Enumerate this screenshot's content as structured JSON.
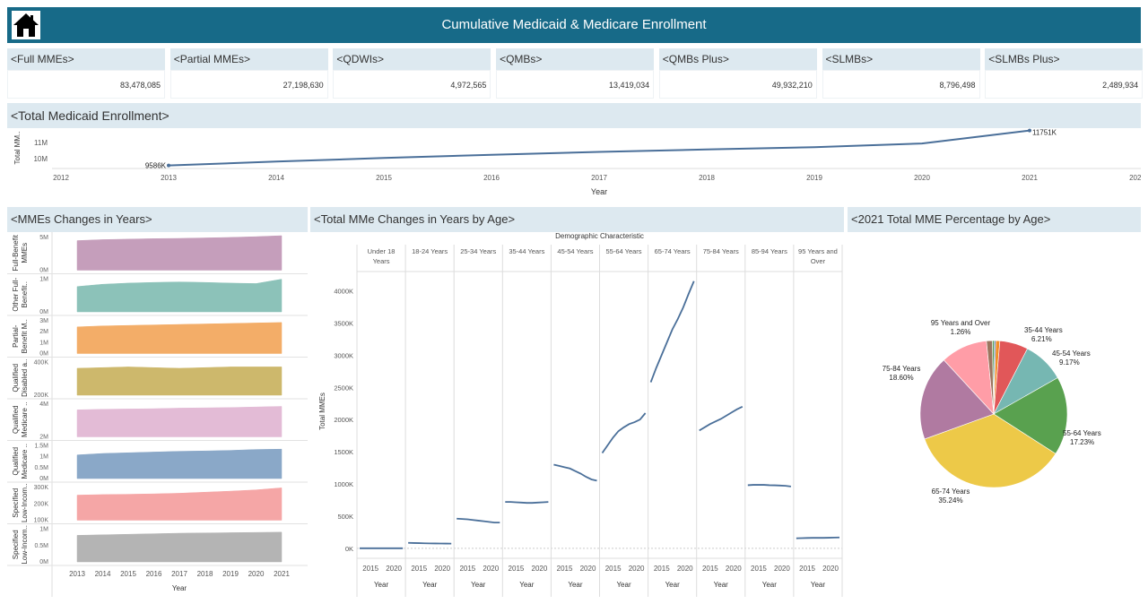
{
  "header": {
    "title": "Cumulative Medicaid & Medicare Enrollment",
    "home_icon": "home-icon"
  },
  "kpis": [
    {
      "label": "<Full MMEs>",
      "value": "83,478,085"
    },
    {
      "label": "<Partial MMEs>",
      "value": "27,198,630"
    },
    {
      "label": "<QDWIs>",
      "value": "4,972,565"
    },
    {
      "label": "<QMBs>",
      "value": "13,419,034"
    },
    {
      "label": "<QMBs Plus>",
      "value": "49,932,210"
    },
    {
      "label": "<SLMBs>",
      "value": "8,796,498"
    },
    {
      "label": "<SLMBs Plus>",
      "value": "2,489,934"
    }
  ],
  "medicaid": {
    "title": "<Total Medicaid Enrollment>",
    "ylabel": "Total MM..",
    "xlabel": "Year",
    "yticks": [
      "11M",
      "10M"
    ],
    "xticks": [
      "2012",
      "2013",
      "2014",
      "2015",
      "2016",
      "2017",
      "2018",
      "2019",
      "2020",
      "2021",
      "2022"
    ],
    "start_label": "9586K",
    "end_label": "11751K"
  },
  "mme_years": {
    "title": "<MMEs Changes in Years>",
    "xlabel": "Year",
    "xticks": [
      "2013",
      "2014",
      "2015",
      "2016",
      "2017",
      "2018",
      "2019",
      "2020",
      "2021"
    ],
    "rows": [
      {
        "label1": "Full-Benefit",
        "label2": "MMEs",
        "ticks": [
          "5M",
          "0M"
        ]
      },
      {
        "label1": "Other Full-",
        "label2": "Benefit..",
        "ticks": [
          "1M",
          "0M"
        ]
      },
      {
        "label1": "Partial-",
        "label2": "Benefit M..",
        "ticks": [
          "3M",
          "2M",
          "1M",
          "0M"
        ]
      },
      {
        "label1": "Qualified",
        "label2": "Disabled a..",
        "ticks": [
          "400K",
          "200K"
        ]
      },
      {
        "label1": "Qualified",
        "label2": "Medicare ..",
        "ticks": [
          "4M",
          "2M"
        ]
      },
      {
        "label1": "Qualified",
        "label2": "Medicare ..",
        "ticks": [
          "1.5M",
          "1M",
          "0.5M",
          "0M"
        ]
      },
      {
        "label1": "Specified",
        "label2": "Low-Incom..",
        "ticks": [
          "300K",
          "200K",
          "100K"
        ]
      },
      {
        "label1": "Specified",
        "label2": "Low-Incom..",
        "ticks": [
          "1M",
          "0.5M",
          "0M"
        ]
      }
    ]
  },
  "age_changes": {
    "title": "<Total MMe Changes in Years by Age>",
    "group_header": "Demographic Characteristic",
    "ylabel": "Total MMEs",
    "xlabel": "Year",
    "xticks": [
      "2015",
      "2020"
    ],
    "yticks": [
      "4000K",
      "3500K",
      "3000K",
      "2500K",
      "2000K",
      "1500K",
      "1000K",
      "500K",
      "0K"
    ],
    "columns": [
      {
        "line1": "Under 18",
        "line2": "Years"
      },
      {
        "line1": "18-24 Years",
        "line2": ""
      },
      {
        "line1": "25-34 Years",
        "line2": ""
      },
      {
        "line1": "35-44 Years",
        "line2": ""
      },
      {
        "line1": "45-54 Years",
        "line2": ""
      },
      {
        "line1": "55-64 Years",
        "line2": ""
      },
      {
        "line1": "65-74 Years",
        "line2": ""
      },
      {
        "line1": "75-84 Years",
        "line2": ""
      },
      {
        "line1": "85-94 Years",
        "line2": ""
      },
      {
        "line1": "95 Years and",
        "line2": "Over"
      }
    ]
  },
  "pie": {
    "title": "<2021 Total MME Percentage by Age>"
  },
  "colors": {
    "header": "#176a88",
    "panel_title_bg": "#dde9f0",
    "line": "#4a6f99"
  },
  "chart_data": [
    {
      "type": "line",
      "x": [
        2013,
        2014,
        2015,
        2016,
        2017,
        2018,
        2019,
        2020,
        2021
      ],
      "series": [
        {
          "values": [
            9586,
            9830,
            10050,
            10250,
            10430,
            10580,
            10720,
            10950,
            11751
          ]
        }
      ],
      "start_label": "9586K",
      "end_label": "11751K",
      "ylabel": "Total MM..",
      "xlabel": "Year",
      "xlim": [
        2012,
        2022
      ],
      "ylim": [
        9400,
        11900
      ]
    },
    {
      "type": "area",
      "x": [
        2013,
        2014,
        2015,
        2016,
        2017,
        2018,
        2019,
        2020,
        2021
      ],
      "xlabel": "Year",
      "series": [
        {
          "name": "Full-Benefit MMEs",
          "color": "#c59ebb",
          "ymax": 7000000,
          "values": [
            6000000,
            6200000,
            6300000,
            6400000,
            6450000,
            6550000,
            6650000,
            6800000,
            7000000
          ]
        },
        {
          "name": "Other Full-Benefit..",
          "color": "#8cc2b9",
          "ymax": 1500000,
          "values": [
            1100000,
            1200000,
            1250000,
            1280000,
            1300000,
            1280000,
            1250000,
            1230000,
            1420000
          ]
        },
        {
          "name": "Partial-Benefit M..",
          "color": "#f3ad68",
          "ymax": 3500000,
          "values": [
            2700000,
            2800000,
            2850000,
            2900000,
            2950000,
            3000000,
            3050000,
            3100000,
            3150000
          ]
        },
        {
          "name": "Qualified Disabled a..",
          "color": "#cdb86c",
          "ymax": 500000,
          "values": [
            390000,
            400000,
            410000,
            400000,
            390000,
            400000,
            410000,
            410000,
            410000
          ]
        },
        {
          "name": "Qualified Medicare ..",
          "color": "#e3bbd6",
          "ymax": 6000000,
          "values": [
            4700000,
            4800000,
            4850000,
            4900000,
            5000000,
            5050000,
            5100000,
            5200000,
            5300000
          ]
        },
        {
          "name": "Qualified Medicare ..",
          "color": "#8aa8c8",
          "ymax": 1900000,
          "values": [
            1300000,
            1380000,
            1420000,
            1460000,
            1500000,
            1520000,
            1550000,
            1600000,
            1620000
          ]
        },
        {
          "name": "Specified Low-Incom..",
          "color": "#f5a6a6",
          "ymax": 330000,
          "values": [
            240000,
            245000,
            248000,
            252000,
            258000,
            268000,
            278000,
            290000,
            310000
          ]
        },
        {
          "name": "Specified Low-Incom..",
          "color": "#b4b4b4",
          "ymax": 1300000,
          "values": [
            1000000,
            1020000,
            1040000,
            1060000,
            1080000,
            1090000,
            1100000,
            1110000,
            1120000
          ]
        }
      ]
    },
    {
      "type": "line",
      "ylabel": "Total MMEs",
      "xlabel": "Year",
      "ylim": [
        -100,
        4300
      ],
      "x": [
        2013,
        2014,
        2015,
        2016,
        2017,
        2018,
        2019,
        2020,
        2021
      ],
      "series": [
        {
          "name": "Under 18 Years",
          "values": [
            0,
            0,
            0,
            0,
            0,
            0,
            0,
            0,
            0
          ]
        },
        {
          "name": "18-24 Years",
          "values": [
            85,
            82,
            80,
            78,
            76,
            75,
            74,
            73,
            72
          ]
        },
        {
          "name": "25-34 Years",
          "values": [
            460,
            455,
            450,
            440,
            430,
            420,
            410,
            400,
            400
          ]
        },
        {
          "name": "35-44 Years",
          "values": [
            720,
            720,
            715,
            710,
            705,
            705,
            710,
            715,
            720
          ]
        },
        {
          "name": "45-54 Years",
          "values": [
            1300,
            1280,
            1260,
            1240,
            1200,
            1160,
            1110,
            1070,
            1050
          ]
        },
        {
          "name": "55-64 Years",
          "values": [
            1480,
            1600,
            1720,
            1820,
            1880,
            1930,
            1960,
            2000,
            2100
          ]
        },
        {
          "name": "65-74 Years",
          "values": [
            2580,
            2800,
            3000,
            3200,
            3400,
            3560,
            3740,
            3950,
            4150
          ]
        },
        {
          "name": "75-84 Years",
          "values": [
            1830,
            1880,
            1930,
            1970,
            2010,
            2060,
            2110,
            2160,
            2200
          ]
        },
        {
          "name": "85-94 Years",
          "values": [
            980,
            985,
            985,
            985,
            980,
            978,
            975,
            970,
            960
          ]
        },
        {
          "name": "95 Years and Over",
          "values": [
            155,
            158,
            160,
            162,
            162,
            162,
            164,
            166,
            168
          ]
        }
      ]
    },
    {
      "type": "pie",
      "slices": [
        {
          "label": "Under 18 Years",
          "value": 0.4,
          "color": "#59a14f"
        },
        {
          "label": "18-24 Years",
          "value": 0.35,
          "color": "#4e79a7"
        },
        {
          "label": "25-34 Years",
          "value": 0.9,
          "color": "#f28e2b"
        },
        {
          "label": "35-44 Years",
          "value": 6.21,
          "color": "#e15759",
          "shown": "6.21%"
        },
        {
          "label": "45-54 Years",
          "value": 9.17,
          "color": "#76b7b2",
          "shown": "9.17%"
        },
        {
          "label": "55-64 Years",
          "value": 17.23,
          "color": "#59a14f",
          "shown": "17.23%"
        },
        {
          "label": "65-74 Years",
          "value": 35.24,
          "color": "#edc948",
          "shown": "35.24%"
        },
        {
          "label": "75-84 Years",
          "value": 18.6,
          "color": "#b07aa1",
          "shown": "18.60%"
        },
        {
          "label": "85-94 Years",
          "value": 10.24,
          "color": "#ff9da7"
        },
        {
          "label": "95 Years and Over",
          "value": 1.26,
          "color": "#9c755f",
          "shown": "1.26%"
        }
      ]
    }
  ]
}
